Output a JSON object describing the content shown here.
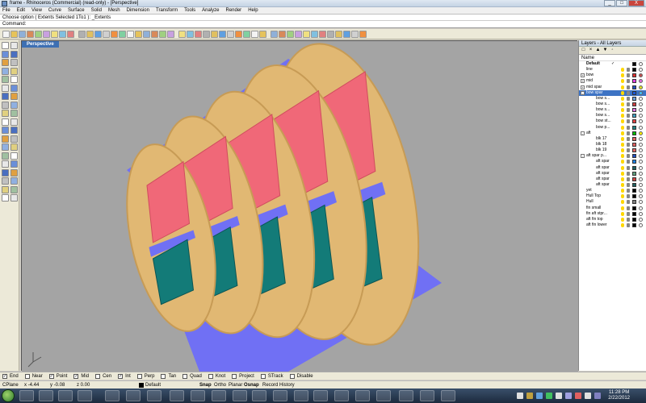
{
  "titlebar": {
    "title": "frame - Rhinoceros (Commercial) (read-only) - [Perspective]"
  },
  "window_buttons": [
    "_",
    "□",
    "X"
  ],
  "menu": [
    "File",
    "Edit",
    "View",
    "Curve",
    "Surface",
    "Solid",
    "Mesh",
    "Dimension",
    "Transform",
    "Tools",
    "Analyze",
    "Render",
    "Help"
  ],
  "command": {
    "history": "Choose option ( Extents  Selected  1To1 ): _Extents",
    "prompt": "Command:"
  },
  "viewport": {
    "label": "Perspective"
  },
  "layers_panel": {
    "title": "Layers - All Layers",
    "column_name": "Name",
    "tool_glyphs": [
      "□",
      "×",
      "▲",
      "▼",
      "◦"
    ],
    "rows": [
      {
        "name": "Default",
        "check": "✓",
        "color": "#000000",
        "bulb": "#ffd800",
        "mat": "#ffffff",
        "indent": 0,
        "bold": true
      },
      {
        "name": "line",
        "color": "#000000",
        "bulb": "#ffd800",
        "mat": "#ffffff",
        "indent": 0
      },
      {
        "name": "bow",
        "color": "#e03030",
        "bulb": "#ffd800",
        "mat": "#c05050",
        "indent": 0,
        "expand": "+"
      },
      {
        "name": "mid",
        "color": "#e040e0",
        "bulb": "#ffd800",
        "mat": "#e070e0",
        "indent": 0,
        "expand": "+"
      },
      {
        "name": "mid spar",
        "color": "#2050c0",
        "bulb": "#ffd800",
        "mat": "#e0e020",
        "indent": 0,
        "expand": "+"
      },
      {
        "name": "bow spar",
        "color": "#1c58d8",
        "bulb": "#ffd800",
        "mat": "#40c0ff",
        "indent": 0,
        "expand": "-",
        "selected": true
      },
      {
        "name": "bow s...",
        "color": "#6aa0e0",
        "bulb": "#ffd800",
        "mat": "#ffffff",
        "indent": 2
      },
      {
        "name": "bow s...",
        "color": "#d04040",
        "bulb": "#ffd800",
        "mat": "#ffffff",
        "indent": 2
      },
      {
        "name": "bow s...",
        "color": "#e070e0",
        "bulb": "#ffd800",
        "mat": "#ffffff",
        "indent": 2
      },
      {
        "name": "bow s...",
        "color": "#40a0c0",
        "bulb": "#ffd800",
        "mat": "#ffffff",
        "indent": 2
      },
      {
        "name": "bow st...",
        "color": "#e04040",
        "bulb": "#ffd800",
        "mat": "#ffffff",
        "indent": 2
      },
      {
        "name": "bow p...",
        "color": "#208080",
        "bulb": "#ffd800",
        "mat": "#ffffff",
        "indent": 2
      },
      {
        "name": "aft",
        "color": "#00c000",
        "bulb": "#ffd800",
        "mat": "#ffee00",
        "indent": 0,
        "expand": "-"
      },
      {
        "name": "blk 17",
        "color": "#e06060",
        "bulb": "#ffd800",
        "mat": "#ffffff",
        "indent": 2
      },
      {
        "name": "blk 18",
        "color": "#e06060",
        "bulb": "#ffd800",
        "mat": "#ffffff",
        "indent": 2
      },
      {
        "name": "blk 19",
        "color": "#e06060",
        "bulb": "#ffd800",
        "mat": "#ffffff",
        "indent": 2
      },
      {
        "name": "aft spar p...",
        "color": "#2050c0",
        "bulb": "#ffd800",
        "mat": "#ffffff",
        "indent": 0,
        "expand": "-"
      },
      {
        "name": "aft spar",
        "color": "#2080e0",
        "bulb": "#ffd800",
        "mat": "#ffffff",
        "indent": 2
      },
      {
        "name": "aft spar",
        "color": "#206060",
        "bulb": "#ffd800",
        "mat": "#ffffff",
        "indent": 2
      },
      {
        "name": "aft spar",
        "color": "#60a080",
        "bulb": "#ffd800",
        "mat": "#ffffff",
        "indent": 2
      },
      {
        "name": "aft spar",
        "color": "#d04040",
        "bulb": "#ffd800",
        "mat": "#ffffff",
        "indent": 2
      },
      {
        "name": "aft spar",
        "color": "#206060",
        "bulb": "#ffd800",
        "mat": "#ffffff",
        "indent": 2
      },
      {
        "name": "yet",
        "color": "#000000",
        "bulb": "#ffd800",
        "mat": "#ffffff",
        "indent": 0
      },
      {
        "name": "Hull Top",
        "color": "#000000",
        "bulb": "#ffd800",
        "mat": "#ffffff",
        "indent": 0
      },
      {
        "name": "Hull",
        "color": "#808080",
        "bulb": "#ffd800",
        "mat": "#ffffff",
        "indent": 0
      },
      {
        "name": "fin small",
        "color": "#000000",
        "bulb": "#ffd800",
        "mat": "#ffffff",
        "indent": 0
      },
      {
        "name": "fin aft stpr...",
        "color": "#000000",
        "bulb": "#ffd800",
        "mat": "#ffffff",
        "indent": 0
      },
      {
        "name": "aft fin top",
        "color": "#000000",
        "bulb": "#ffd800",
        "mat": "#ffffff",
        "indent": 0
      },
      {
        "name": "aft fin lower",
        "color": "#000000",
        "bulb": "#ffd800",
        "mat": "#ffffff",
        "indent": 0
      }
    ]
  },
  "osnaps": [
    {
      "label": "End",
      "checked": true
    },
    {
      "label": "Near",
      "checked": false
    },
    {
      "label": "Point",
      "checked": true
    },
    {
      "label": "Mid",
      "checked": true
    },
    {
      "label": "Cen",
      "checked": false
    },
    {
      "label": "Int",
      "checked": true
    },
    {
      "label": "Perp",
      "checked": false
    },
    {
      "label": "Tan",
      "checked": false
    },
    {
      "label": "Quad",
      "checked": false
    },
    {
      "label": "Knot",
      "checked": false
    },
    {
      "label": "Project",
      "checked": false
    },
    {
      "label": "STrack",
      "checked": false
    },
    {
      "label": "Disable",
      "checked": false
    }
  ],
  "coords": {
    "cplane": "CPlane",
    "x": "x -4.44",
    "y": "y -0.08",
    "z": "z 0.00",
    "layer": "Default",
    "toggles": [
      "Snap",
      "Ortho",
      "Planar",
      "Osnap",
      "Record History"
    ]
  },
  "taskbar": {
    "time": "11:28 PM",
    "date": "2/22/2012"
  },
  "colors": {
    "viewport_bg": "#a4a4a4",
    "frame_tan": "#e1b873",
    "frame_edge": "#c79b55",
    "pink_panel": "#f06878",
    "pink_dark": "#d04c5e",
    "teal_panel": "#137b78",
    "teal_dark": "#0b5553",
    "blue_hull": "#7070f4",
    "selected_blue": "#3d73c4"
  }
}
